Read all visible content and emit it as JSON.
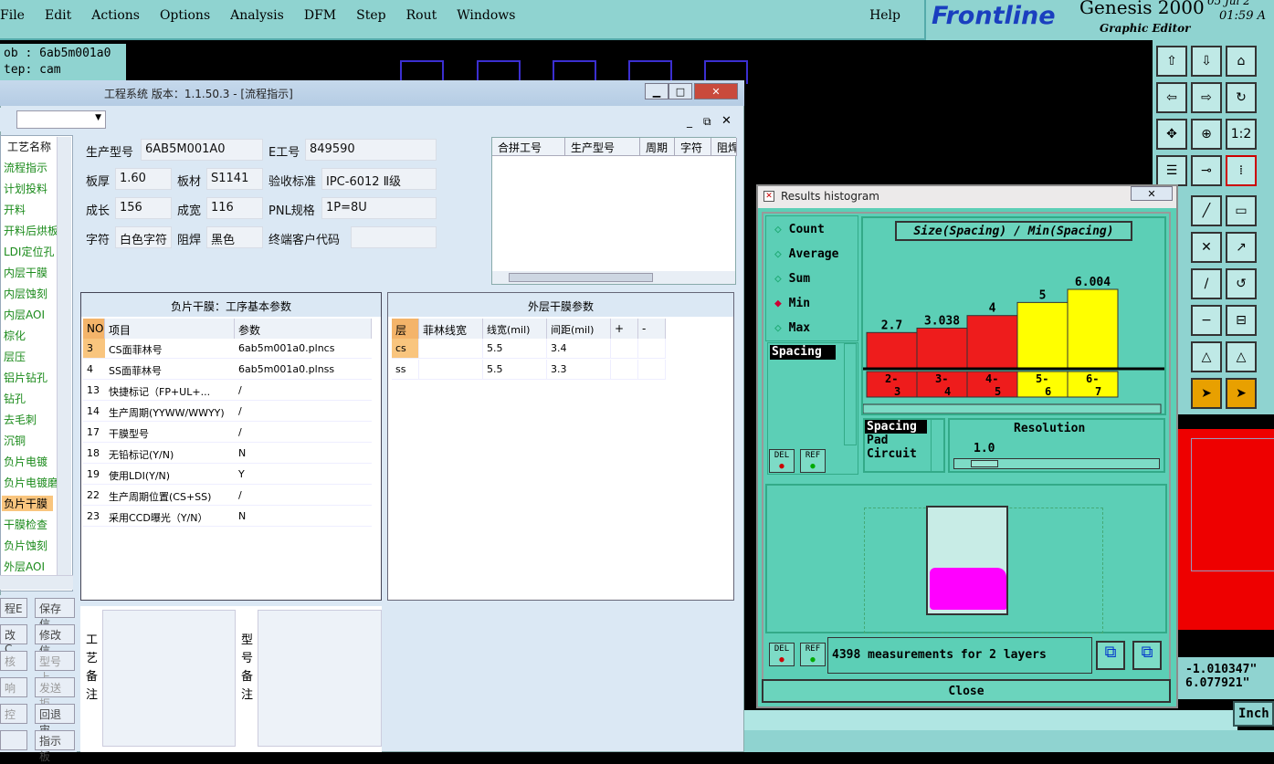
{
  "menubar": {
    "items": [
      "File",
      "Edit",
      "Actions",
      "Options",
      "Analysis",
      "DFM",
      "Step",
      "Rout",
      "Windows"
    ],
    "help": "Help"
  },
  "brand": {
    "frontline": "Frontline",
    "genesis": "Genesis 2000",
    "subtitle": "Graphic Editor",
    "date": "05 Jul 2",
    "time": "01:59 A"
  },
  "jobstep": {
    "job": "ob  :  6ab5m001a0",
    "step": "tep:  cam"
  },
  "coords": {
    "x": "-1.010347\"",
    "y": "6.077921\"",
    "units": "Inch"
  },
  "app": {
    "title_left": "...",
    "title": "工程系统  版本：1.1.50.3 - [流程指示]",
    "nav_items": [
      "工艺名称",
      "流程指示",
      "计划投料",
      "开料",
      "开料后烘板",
      "LDI定位孔",
      "内层干膜",
      "内层蚀刻",
      "内层AOI",
      "棕化",
      "层压",
      "铝片钻孔",
      "钻孔",
      "去毛刺",
      "沉铜",
      "负片电镀",
      "负片电镀磨板",
      "负片干膜",
      "干膜检查",
      "负片蚀刻",
      "外层AOI"
    ],
    "left_buttons": [
      "程E",
      "保存信",
      "改C",
      "修改信",
      "核",
      "型号上",
      "响",
      "发送拒",
      "控",
      "回退审",
      "",
      "指示板"
    ],
    "info": {
      "model_label": "生产型号",
      "model_value": "6AB5M001A0",
      "e_label": "E工号",
      "e_value": "849590",
      "thickness_label": "板厚",
      "thickness_value": "1.60",
      "material_label": "板材",
      "material_value": "S1141",
      "accept_label": "验收标准",
      "accept_value": "IPC-6012 Ⅱ级",
      "length_label": "成长",
      "length_value": "156",
      "width_label": "成宽",
      "width_value": "116",
      "pnl_label": "PNL规格",
      "pnl_value": "1P=8U",
      "char_label": "字符",
      "char_value": "白色字符",
      "mask_label": "阻焊",
      "mask_value": "黑色",
      "customer_label": "终端客户代码",
      "customer_value": ""
    },
    "merge_headers": [
      "合拼工号",
      "生产型号",
      "周期",
      "字符",
      "阻焊"
    ],
    "left_panel": {
      "title": "负片干膜：工序基本参数",
      "headers": [
        "NO",
        "项目",
        "参数"
      ],
      "rows": [
        [
          "3",
          "CS面菲林号",
          "6ab5m001a0.plncs"
        ],
        [
          "4",
          "SS面菲林号",
          "6ab5m001a0.plnss"
        ],
        [
          "13",
          "快捷标记（FP+UL+...",
          "/"
        ],
        [
          "14",
          "生产周期(YYWW/WWYY)",
          "/"
        ],
        [
          "17",
          "干膜型号",
          "/"
        ],
        [
          "18",
          "无铅标记(Y/N)",
          "N"
        ],
        [
          "19",
          "使用LDI(Y/N)",
          "Y"
        ],
        [
          "22",
          "生产周期位置(CS+SS)",
          "/"
        ],
        [
          "23",
          "采用CCD曝光（Y/N）",
          "N"
        ]
      ]
    },
    "right_panel": {
      "title": "外层干膜参数",
      "headers": [
        "层",
        "菲林线宽",
        "线宽(mil)",
        "间距(mil)",
        "+",
        "-"
      ],
      "rows": [
        [
          "cs",
          "",
          "5.5",
          "3.4",
          "",
          ""
        ],
        [
          "ss",
          "",
          "5.5",
          "3.3",
          "",
          ""
        ]
      ]
    },
    "notes_label1": "工艺备注",
    "notes_label2": "型号备注"
  },
  "histogram": {
    "window_title": "Results histogram",
    "radios": [
      "Count",
      "Average",
      "Sum",
      "Min",
      "Max"
    ],
    "selected_radio": "Min",
    "list_selected": "Spacing",
    "chart_title": "Size(Spacing) / Min(Spacing)",
    "layer_types": [
      "Spacing",
      "Pad",
      "Circuit"
    ],
    "resolution_label": "Resolution",
    "resolution_value": "1.0",
    "del_label": "DEL",
    "ref_label": "REF",
    "status": "4398 measurements for 2 layers",
    "close_label": "Close"
  },
  "chart_data": {
    "type": "bar",
    "title": "Size(Spacing) / Min(Spacing)",
    "categories": [
      "2-3",
      "3-4",
      "4-5",
      "5-6",
      "6-7"
    ],
    "values": [
      2.7,
      3.038,
      4,
      5,
      6.004
    ],
    "value_labels": [
      "2.7",
      "3.038",
      "4",
      "5",
      "6.004"
    ],
    "colors": [
      "#ee1c1c",
      "#ee1c1c",
      "#ee1c1c",
      "#ffff00",
      "#ffff00"
    ]
  }
}
